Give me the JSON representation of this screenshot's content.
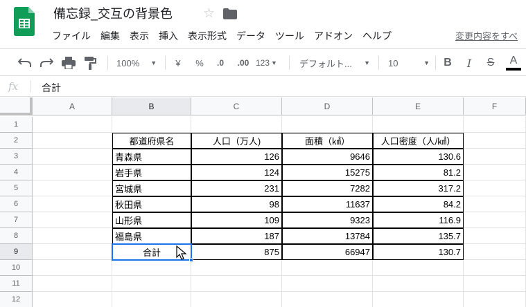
{
  "app": {
    "doc_title": "備忘録_交互の背景色",
    "logo_icon": "google-sheets-logo-icon",
    "star_icon": "☆",
    "accent": "#1a73e8",
    "logo_color": "#0f9d58"
  },
  "menu": {
    "items": [
      "ファイル",
      "編集",
      "表示",
      "挿入",
      "表示形式",
      "データ",
      "ツール",
      "アドオン",
      "ヘルプ"
    ],
    "changes_link": "変更内容をすべ"
  },
  "toolbar": {
    "zoom": "100%",
    "currency": "¥",
    "percent": "%",
    "decrease_decimal": ".0",
    "increase_decimal": ".00",
    "more_formats": "123",
    "font": "デフォルト...",
    "font_size": "10",
    "bold": "B",
    "italic": "I",
    "strikethrough": "S",
    "text_color": "A"
  },
  "formula_bar": {
    "fx_label": "fx",
    "value": "合計"
  },
  "sheet": {
    "columns": [
      "A",
      "B",
      "C",
      "D",
      "E",
      "F"
    ],
    "rows": [
      "1",
      "2",
      "3",
      "4",
      "5",
      "6",
      "7",
      "8",
      "9",
      "10",
      "11",
      "12"
    ],
    "selected_column": "B",
    "selected_row": "9",
    "table_header": [
      "都道府県名",
      "人口（万人)",
      "面積（㎢）",
      "人口密度（人/㎢）"
    ],
    "table_rows": [
      [
        "青森県",
        "126",
        "9646",
        "130.6"
      ],
      [
        "岩手県",
        "124",
        "15275",
        "81.2"
      ],
      [
        "宮城県",
        "231",
        "7282",
        "317.2"
      ],
      [
        "秋田県",
        "98",
        "11637",
        "84.2"
      ],
      [
        "山形県",
        "109",
        "9323",
        "116.9"
      ],
      [
        "福島県",
        "187",
        "13784",
        "135.7"
      ]
    ],
    "total_row": [
      "合計",
      "875",
      "66947",
      "130.7"
    ]
  }
}
